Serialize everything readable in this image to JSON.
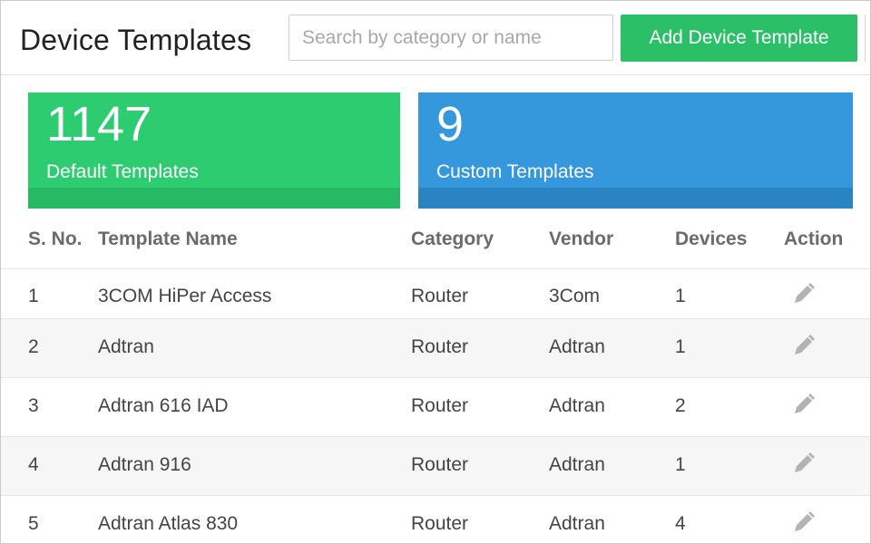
{
  "header": {
    "title": "Device Templates",
    "search_placeholder": "Search by category or name",
    "add_button": "Add Device Template"
  },
  "cards": [
    {
      "count": "1147",
      "label": "Default Templates",
      "color": "#2ecc71"
    },
    {
      "count": "9",
      "label": "Custom Templates",
      "color": "#3598dc"
    }
  ],
  "table": {
    "columns": [
      "S. No.",
      "Template Name",
      "Category",
      "Vendor",
      "Devices",
      "Action"
    ],
    "rows": [
      {
        "sno": "1",
        "name": "3COM HiPer Access",
        "category": "Router",
        "vendor": "3Com",
        "devices": "1"
      },
      {
        "sno": "2",
        "name": "Adtran",
        "category": "Router",
        "vendor": "Adtran",
        "devices": "1"
      },
      {
        "sno": "3",
        "name": "Adtran 616 IAD",
        "category": "Router",
        "vendor": "Adtran",
        "devices": "2"
      },
      {
        "sno": "4",
        "name": "Adtran 916",
        "category": "Router",
        "vendor": "Adtran",
        "devices": "1"
      },
      {
        "sno": "5",
        "name": "Adtran Atlas 830",
        "category": "Router",
        "vendor": "Adtran",
        "devices": "4"
      }
    ],
    "action_icon": "pencil-icon"
  }
}
